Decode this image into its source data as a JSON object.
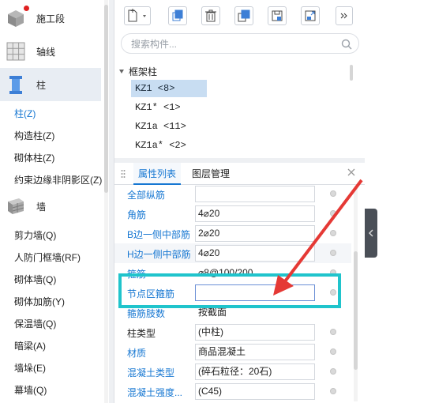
{
  "sidebar": {
    "categories": [
      {
        "label": "施工段",
        "icon": "cube-icon"
      },
      {
        "label": "轴线",
        "icon": "grid-icon"
      },
      {
        "label": "柱",
        "icon": "column-icon"
      },
      {
        "label": "墙",
        "icon": "wall-icon"
      }
    ],
    "column_items": [
      "柱(Z)",
      "构造柱(Z)",
      "砌体柱(Z)",
      "约束边缘非阴影区(Z)"
    ],
    "wall_items": [
      "剪力墙(Q)",
      "人防门框墙(RF)",
      "砌体墙(Q)",
      "砌体加筋(Y)",
      "保温墙(Q)",
      "暗梁(A)",
      "墙垛(E)",
      "幕墙(Q)"
    ]
  },
  "search": {
    "placeholder": "搜索构件..."
  },
  "tree": {
    "group": "框架柱",
    "items": [
      "KZ1 <8>",
      "KZ1* <1>",
      "KZ1a <11>",
      "KZ1a* <2>"
    ]
  },
  "tabs": {
    "properties": "属性列表",
    "layers": "图层管理"
  },
  "properties": [
    {
      "name": "全部纵筋",
      "value": "",
      "blue": true
    },
    {
      "name": "角筋",
      "value": "4⌀20",
      "blue": true
    },
    {
      "name": "B边一侧中部筋",
      "value": "2⌀20",
      "blue": true
    },
    {
      "name": "H边一侧中部筋",
      "value": "4⌀20",
      "blue": true
    },
    {
      "name": "箍筋",
      "value": "⌀8@100/200",
      "blue": true
    },
    {
      "name": "节点区箍筋",
      "value": "",
      "blue": true
    },
    {
      "name": "箍筋肢数",
      "value": "按截面",
      "blue": true
    },
    {
      "name": "柱类型",
      "value": "(中柱)",
      "blue": false
    },
    {
      "name": "材质",
      "value": "商品混凝土",
      "blue": true
    },
    {
      "name": "混凝土类型",
      "value": "(碎石粒径：20石)",
      "blue": true
    },
    {
      "name": "混凝土强度...",
      "value": "(C45)",
      "blue": true
    }
  ],
  "colors": {
    "accent": "#1677d2",
    "highlight": "#20c4cc",
    "arrow": "#e53935",
    "selected": "#c8ddf2"
  }
}
